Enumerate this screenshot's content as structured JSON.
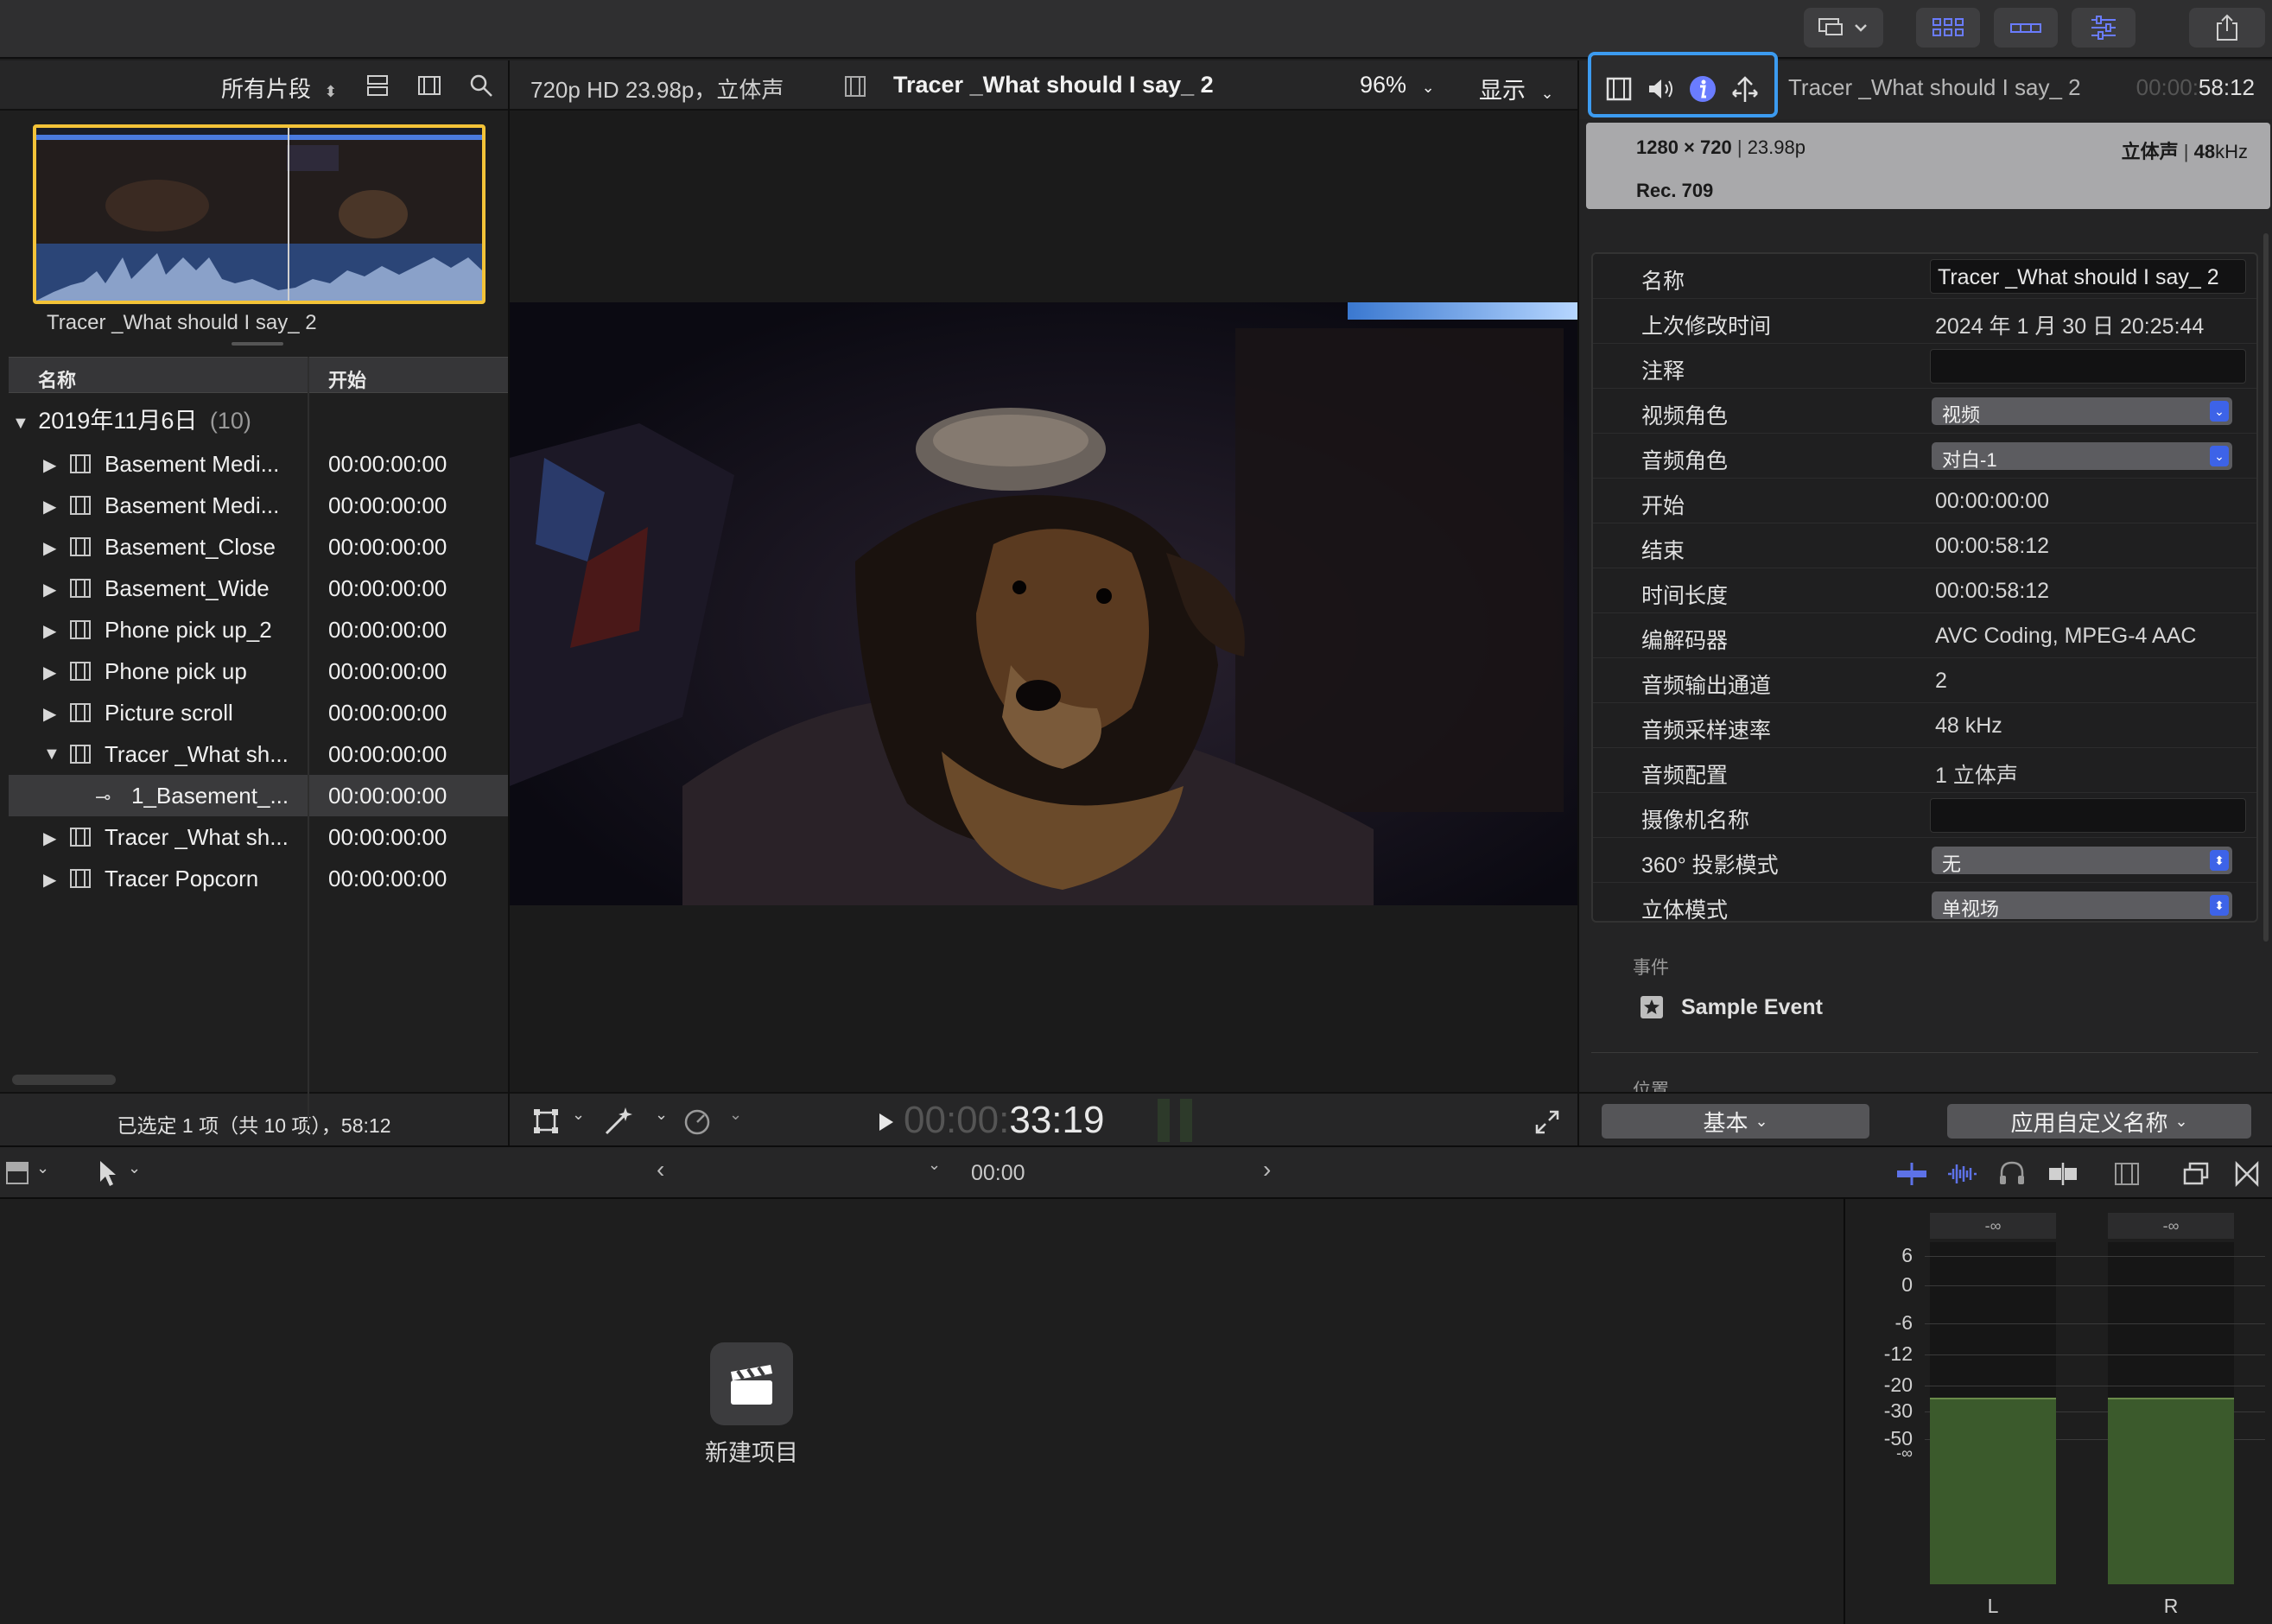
{
  "browser": {
    "filter_label": "所有片段",
    "thumb_label": "Tracer _What should I say_ 2",
    "columns": {
      "name": "名称",
      "start": "开始"
    },
    "group": {
      "label": "2019年11月6日",
      "count": "(10)"
    },
    "rows": [
      {
        "name": "Basement Medi...",
        "start": "00:00:00:00"
      },
      {
        "name": "Basement Medi...",
        "start": "00:00:00:00"
      },
      {
        "name": "Basement_Close",
        "start": "00:00:00:00"
      },
      {
        "name": "Basement_Wide",
        "start": "00:00:00:00"
      },
      {
        "name": "Phone pick up_2",
        "start": "00:00:00:00"
      },
      {
        "name": "Phone pick up",
        "start": "00:00:00:00"
      },
      {
        "name": "Picture scroll",
        "start": "00:00:00:00"
      },
      {
        "name": "Tracer _What sh...",
        "start": "00:00:00:00"
      },
      {
        "name": "1_Basement_...",
        "start": "00:00:00:00"
      },
      {
        "name": "Tracer _What sh...",
        "start": "00:00:00:00"
      },
      {
        "name": "Tracer Popcorn",
        "start": "00:00:00:00"
      }
    ],
    "footer_status": "已选定 1 项（共 10 项），58:12"
  },
  "viewer": {
    "format": "720p HD 23.98p，立体声",
    "clip_title": "Tracer _What should I say_ 2",
    "zoom": "96%",
    "display_menu": "显示",
    "timecode_dim": "00:00:",
    "timecode_bright": "33:19"
  },
  "inspector": {
    "clip_title": "Tracer _What should I say_ 2",
    "duration_dim": "00:00:",
    "duration_bright": "58:12",
    "summary_res": "1280 × 720",
    "summary_fps": "23.98p",
    "summary_audio": "立体声",
    "summary_rate": "48",
    "summary_rate_unit": "kHz",
    "summary_color": "Rec. 709",
    "props": {
      "name_label": "名称",
      "name_value": "Tracer _What should I say_ 2",
      "modified_label": "上次修改时间",
      "modified_value": "2024 年 1 月 30 日 20:25:44",
      "notes_label": "注释",
      "video_role_label": "视频角色",
      "video_role_value": "视频",
      "audio_role_label": "音频角色",
      "audio_role_value": "对白-1",
      "start_label": "开始",
      "start_value": "00:00:00:00",
      "end_label": "结束",
      "end_value": "00:00:58:12",
      "duration_label": "时间长度",
      "duration_value": "00:00:58:12",
      "codec_label": "编解码器",
      "codec_value": "AVC Coding, MPEG-4 AAC",
      "channels_label": "音频输出通道",
      "channels_value": "2",
      "samplerate_label": "音频采样速率",
      "samplerate_value": "48 kHz",
      "audioconfig_label": "音频配置",
      "audioconfig_value": "1 立体声",
      "camera_label": "摄像机名称",
      "projection_label": "360° 投影模式",
      "projection_value": "无",
      "stereo_label": "立体模式",
      "stereo_value": "单视场"
    },
    "event_section": "事件",
    "event_name": "Sample Event",
    "location_section": "位置",
    "basic_button": "基本",
    "custom_name_button": "应用自定义名称"
  },
  "timeline": {
    "timecode": "00:00",
    "new_project": "新建项目"
  },
  "meters": {
    "peak_l": "-∞",
    "peak_r": "-∞",
    "ticks": [
      "6",
      "0",
      "-6",
      "-12",
      "-20",
      "-30",
      "-50",
      "-∞"
    ],
    "channel_l": "L",
    "channel_r": "R",
    "level_color": "#3b5a2c"
  }
}
